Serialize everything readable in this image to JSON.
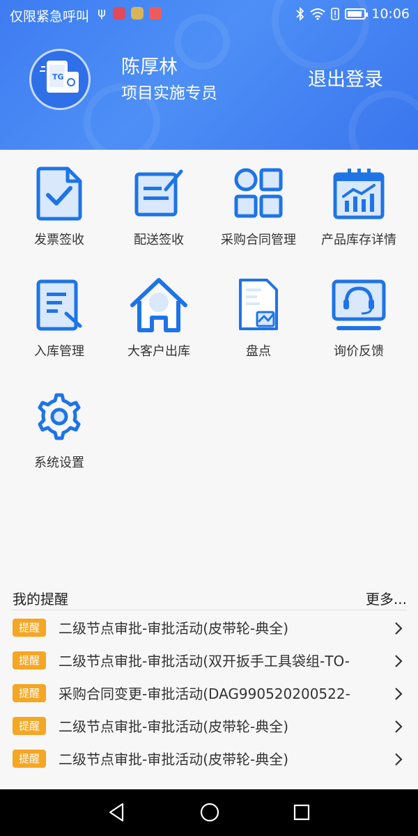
{
  "status_bar": {
    "carrier": "仅限紧急呼叫",
    "time": "10:06",
    "usb_icon": "usb-icon",
    "bluetooth_icon": "bluetooth-icon",
    "wifi_icon": "wifi-icon",
    "alert_icon": "alert-icon",
    "battery_icon": "battery-icon"
  },
  "header": {
    "avatar_label": "TG",
    "user_name": "陈厚林",
    "user_role": "项目实施专员",
    "logout_label": "退出登录"
  },
  "grid": {
    "items": [
      {
        "label": "发票签收",
        "icon": "invoice-check-icon"
      },
      {
        "label": "配送签收",
        "icon": "delivery-sign-icon"
      },
      {
        "label": "采购合同管理",
        "icon": "contract-grid-icon"
      },
      {
        "label": "产品库存详情",
        "icon": "inventory-chart-icon"
      },
      {
        "label": "入库管理",
        "icon": "warehouse-doc-icon"
      },
      {
        "label": "大客户出库",
        "icon": "house-icon"
      },
      {
        "label": "盘点",
        "icon": "stocktake-doc-icon"
      },
      {
        "label": "询价反馈",
        "icon": "headset-monitor-icon"
      },
      {
        "label": "系统设置",
        "icon": "gear-icon"
      }
    ]
  },
  "reminders": {
    "title": "我的提醒",
    "more_label": "更多...",
    "badge_label": "提醒",
    "items": [
      {
        "text": "二级节点审批-审批活动(皮带轮-典全)"
      },
      {
        "text": "二级节点审批-审批活动(双开扳手工具袋组-TO-"
      },
      {
        "text": "采购合同变更-审批活动(DAG990520200522-"
      },
      {
        "text": "二级节点审批-审批活动(皮带轮-典全)"
      },
      {
        "text": "二级节点审批-审批活动(皮带轮-典全)"
      }
    ]
  },
  "colors": {
    "header_blue": "#3e7cf1",
    "icon_blue": "#1e74e6",
    "icon_fill": "#d9e8fb",
    "badge_orange": "#f5a623"
  }
}
